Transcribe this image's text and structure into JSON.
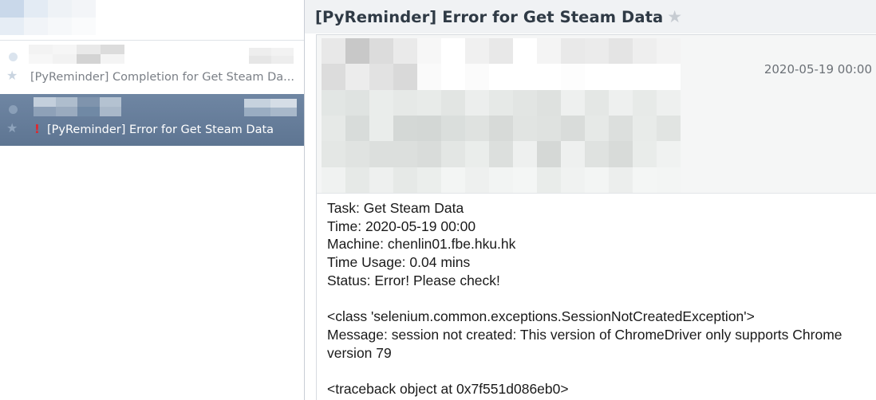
{
  "message_list": {
    "items": [
      {
        "subject": "[PyReminder] Completion for Get Steam Da...",
        "selected": false,
        "flagged": false
      },
      {
        "subject": "[PyReminder] Error for Get Steam Data",
        "selected": true,
        "flagged": true
      }
    ]
  },
  "reading_pane": {
    "subject": "[PyReminder] Error for Get Steam Data",
    "date": "2020-05-19 00:00",
    "body_lines": [
      "Task: Get Steam Data",
      "Time: 2020-05-19 00:00",
      "Machine: chenlin01.fbe.hku.hk",
      "Time Usage: 0.04 mins",
      "Status: Error! Please check!",
      "",
      "<class 'selenium.common.exceptions.SessionNotCreatedException'>",
      "Message: session not created: This version of ChromeDriver only supports Chrome",
      "version 79",
      "",
      "<traceback object at 0x7f551d086eb0>"
    ]
  },
  "icons": {
    "star": "★",
    "priority": "!"
  },
  "colors": {
    "selected_row": "#6a819e",
    "priority_red": "#e4242b",
    "subject_bar": "#f0f2f4"
  }
}
